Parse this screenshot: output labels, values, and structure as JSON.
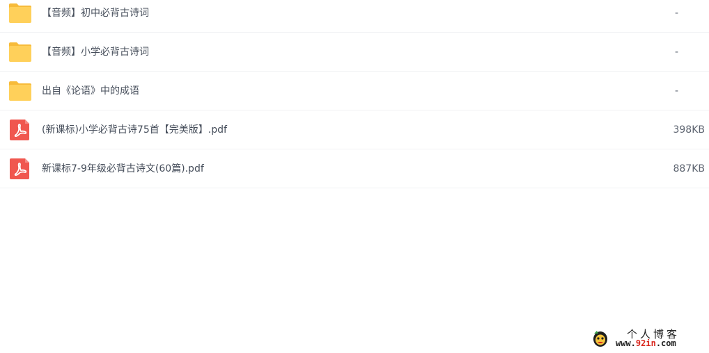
{
  "files": [
    {
      "type": "folder",
      "name": "【音频】初中必背古诗词",
      "size": "-"
    },
    {
      "type": "folder",
      "name": "【音频】小学必背古诗词",
      "size": "-"
    },
    {
      "type": "folder",
      "name": "出自《论语》中的成语",
      "size": "-"
    },
    {
      "type": "pdf",
      "name": "(新课标)小学必背古诗75首【完美版】.pdf",
      "size": "398KB"
    },
    {
      "type": "pdf",
      "name": "新课标7-9年级必背古诗文(60篇).pdf",
      "size": "887KB"
    }
  ],
  "watermark": {
    "title": "个人博客",
    "url_prefix": "www.",
    "url_accent": "92in",
    "url_suffix": ".com"
  },
  "colors": {
    "folder": "#ffd05a",
    "folder_tab": "#f7bb3a",
    "pdf": "#f0574f",
    "text": "#454d5a",
    "divider": "#f1f2f4"
  },
  "icons": {
    "folder": "folder-icon",
    "pdf": "pdf-icon"
  }
}
